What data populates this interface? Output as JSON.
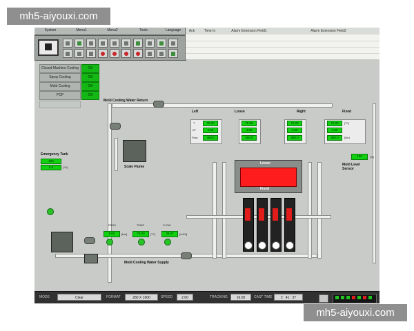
{
  "watermarks": {
    "top": "mh5-aiyouxi.com",
    "bottom": "mh5-aiyouxi.com"
  },
  "menu": [
    "System",
    "Menu1",
    "Menu2",
    "Tools",
    "Language"
  ],
  "alarm_table": {
    "columns": [
      "Ack",
      "Time In",
      "Alarm Extension Field1",
      "Alarm Extension Field2"
    ]
  },
  "left_panel": {
    "rows": [
      {
        "label": "Closed Machine Cooling",
        "status": "OK"
      },
      {
        "label": "Spray Cooling",
        "status": "OK"
      },
      {
        "label": "Mold Cooling",
        "status": "OK"
      },
      {
        "label": "PCP",
        "status": "OK"
      }
    ]
  },
  "emergency_tank": {
    "title": "Emergency Tank",
    "value_top": "100",
    "value_bottom": "5.5",
    "unit": "[%]"
  },
  "labels": {
    "mold_cooling_return": "Mold Cooling Water Return",
    "mold_cooling_supply": "Mold Cooling Water Supply",
    "scale_flume": "Scale Flume",
    "left": "Left",
    "loose": "Loose",
    "right": "Right",
    "fixed": "Fixed",
    "mold_level_sensor": "Mold Level Sensor",
    "loose_center": "Loose",
    "fixed_center": "Fixed",
    "pressure_tag": "PRSS",
    "temp_tag": "TEMP",
    "flow_tag": "FLOW"
  },
  "zones": [
    {
      "name": "Left",
      "t": "75.00",
      "dt": "4.50",
      "flow": "450.0"
    },
    {
      "name": "Loose",
      "t": "75.00",
      "dt": "4.50",
      "flow": "450.0"
    },
    {
      "name": "Right",
      "t": "75.00",
      "dt": "4.50",
      "flow": "450.0"
    },
    {
      "name": "Fixed",
      "t": "75.00",
      "dt": "4.50",
      "flow": "450.0"
    }
  ],
  "symbols": {
    "t": "T",
    "dt": "ΔT",
    "flow": "Flow"
  },
  "units": {
    "temp": "[°C]",
    "flow": "[l/m]"
  },
  "mold_level": {
    "value": "100",
    "unit": "[%]"
  },
  "supply_values": [
    {
      "value": "9.00",
      "unit": "[bar]"
    },
    {
      "value": "75.00",
      "unit": "[°C]"
    },
    {
      "value": "39.47",
      "unit": "[m3/h]"
    }
  ],
  "bottom_bar": {
    "mode_label": "MODE",
    "mode_value": "Clear",
    "format_label": "FORMAT",
    "format_value": "280 X 1600",
    "speed_label": "SPEED",
    "speed_value": "2.00",
    "tracking_label": "TRACKING",
    "tracking_value": "16.00",
    "cast_label": "CAST TIME",
    "cast_value": "2 : 41 : 37"
  },
  "colors": {
    "status_ok": "#14b814",
    "alarm_red": "#ff1c1c"
  }
}
